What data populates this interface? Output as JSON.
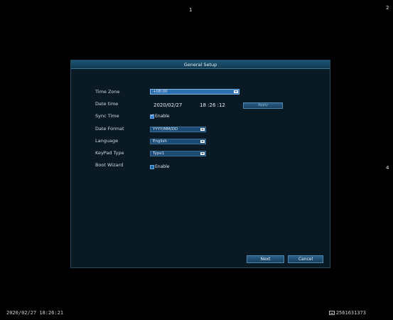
{
  "channels": {
    "ch1": "1",
    "ch2": "2",
    "ch4": "4"
  },
  "dialog": {
    "title": "General Setup",
    "fields": {
      "time_zone": {
        "label": "Time Zone",
        "value": "+08:00"
      },
      "date_time": {
        "label": "Date time",
        "date": "2020/02/27",
        "time": "18 :26 :12",
        "apply_label": "Apply"
      },
      "sync_time": {
        "label": "Sync Time",
        "checkbox_label": "Enable",
        "checked": true
      },
      "date_format": {
        "label": "Date Format",
        "value": "YYYY/MM/DD"
      },
      "language": {
        "label": "Language",
        "value": "English"
      },
      "keypad_type": {
        "label": "KeyPad Type",
        "value": "Type1"
      },
      "boot_wizard": {
        "label": "Boot Wizard",
        "checkbox_label": "Enable",
        "checked": false
      }
    },
    "buttons": {
      "next": "Next",
      "cancel": "Cancel"
    }
  },
  "footer": {
    "datetime": "2020/02/27 18:26:21",
    "device_id": "2561631373",
    "device_icon": "hdd-icon"
  },
  "colors": {
    "background": "#000000",
    "dialog_bg": "#0a1a25",
    "header": "#1d5475",
    "accent": "#2e6fb0"
  }
}
